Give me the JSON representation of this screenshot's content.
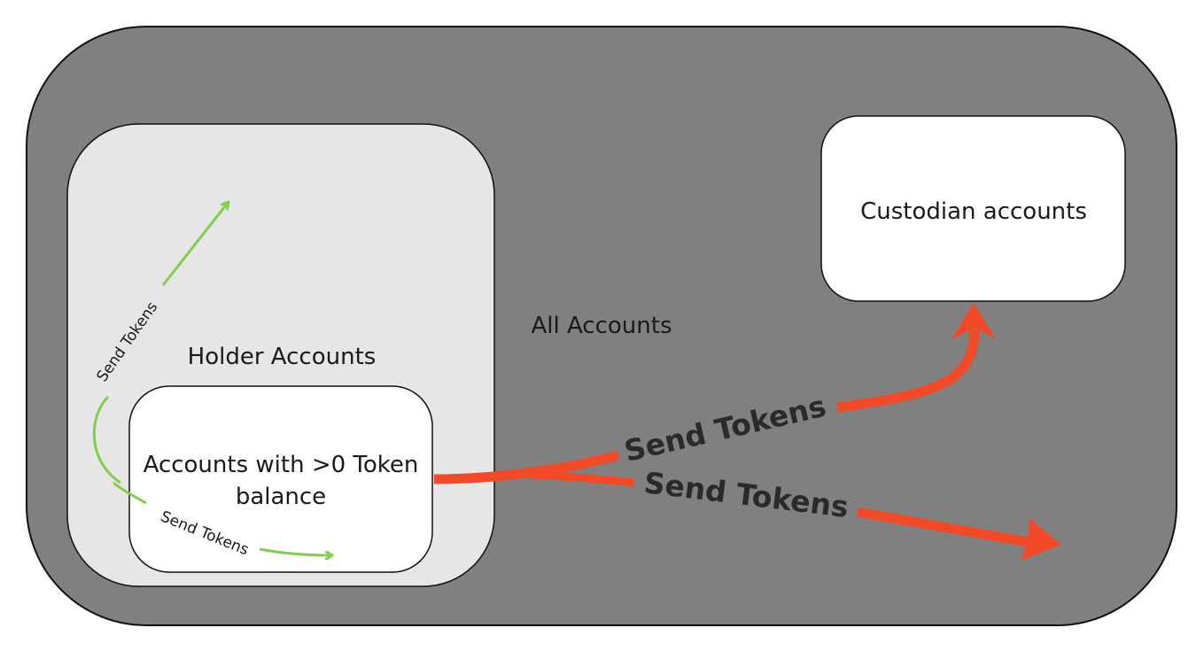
{
  "regions": {
    "all_accounts": {
      "label": "All Accounts",
      "fill": "#808080"
    },
    "holder_accounts": {
      "label": "Holder Accounts",
      "fill": "#e6e6e6"
    },
    "nonzero_accounts": {
      "label_line1": "Accounts with >0 Token",
      "label_line2": "balance",
      "fill": "#ffffff"
    },
    "custodian_accounts": {
      "label": "Custodian accounts",
      "fill": "#ffffff"
    }
  },
  "arrows": {
    "green": {
      "color": "#7ed04b",
      "label_up": "Send Tokens",
      "label_right": "Send Tokens"
    },
    "red": {
      "color": "#f24a26",
      "label_upper": "Send Tokens",
      "label_lower": "Send Tokens"
    }
  }
}
